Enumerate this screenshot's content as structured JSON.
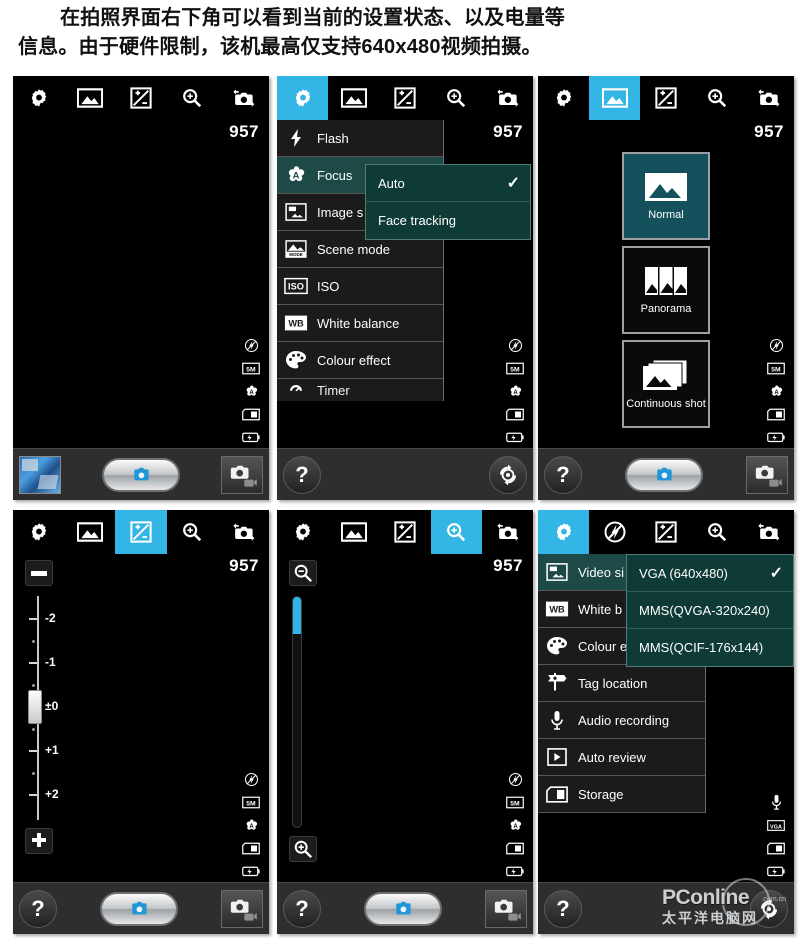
{
  "caption": {
    "line1": "在拍照界面右下角可以看到当前的设置状态、以及电量等",
    "line2": "信息。由于硬件限制，该机最高仅支持640x480视频拍摄。"
  },
  "toolbar": {
    "settings_label": "settings",
    "shot_mode_label": "shot-mode",
    "exposure_label": "exposure",
    "zoom_label": "zoom",
    "switch_camera_label": "switch-camera",
    "flash_label": "flash"
  },
  "common": {
    "counter": "957",
    "help_label": "?",
    "accent_color": "#33b5e5",
    "menu_selected_color": "#1d4a46",
    "submenu_color": "#0e3b36"
  },
  "panels": [
    {
      "id": "panel-camera-idle",
      "active_tool": "shot-mode-none",
      "counter": "957",
      "status_icons": [
        "flash-off-icon",
        "5m-size-icon",
        "auto-focus-icon",
        "sdcard-icon",
        "battery-icon"
      ],
      "bottom": {
        "thumbnail": "last-photo-thumbnail",
        "shutter": "shutter-button",
        "switch": "camera-video-switch"
      }
    },
    {
      "id": "panel-settings-menu",
      "active_tool": "settings",
      "counter": "957",
      "menu": [
        {
          "label": "Flash",
          "icon": "flash-icon",
          "selected": false
        },
        {
          "label": "Focus",
          "icon": "focus-flower-icon",
          "selected": true
        },
        {
          "label": "Image s",
          "icon": "image-size-icon",
          "selected": false
        },
        {
          "label": "Scene mode",
          "icon": "scene-mode-icon",
          "selected": false
        },
        {
          "label": "ISO",
          "icon": "iso-icon",
          "selected": false
        },
        {
          "label": "White balance",
          "icon": "wb-icon",
          "selected": false
        },
        {
          "label": "Colour effect",
          "icon": "palette-icon",
          "selected": false
        },
        {
          "label": "Timer",
          "icon": "timer-icon",
          "selected": false
        }
      ],
      "submenu": {
        "title": "Focus",
        "options": [
          {
            "label": "Auto",
            "checked": true
          },
          {
            "label": "Face tracking",
            "checked": false
          }
        ]
      },
      "status_icons": [
        "flash-off-icon",
        "5m-size-icon",
        "auto-focus-icon",
        "sdcard-icon",
        "battery-icon"
      ],
      "bottom": {
        "help": "?",
        "rotate": "switch-camera-round"
      }
    },
    {
      "id": "panel-shot-mode",
      "active_tool": "shot-mode",
      "counter": "957",
      "modes": [
        {
          "label": "Normal",
          "icon": "photo-icon",
          "selected": true
        },
        {
          "label": "Panorama",
          "icon": "panorama-icon",
          "selected": false
        },
        {
          "label": "Continuous shot",
          "icon": "burst-icon",
          "selected": false
        }
      ],
      "status_icons": [
        "flash-off-icon",
        "5m-size-icon",
        "auto-focus-icon",
        "sdcard-icon",
        "battery-icon"
      ],
      "bottom": {
        "help": "?",
        "shutter": "shutter-button",
        "switch": "camera-video-switch"
      }
    },
    {
      "id": "panel-exposure",
      "active_tool": "exposure",
      "counter": "957",
      "slider": {
        "decrease_label": "exposure-decrease",
        "increase_label": "exposure-increase",
        "ticks": [
          "-2",
          "-1",
          "±0",
          "+1",
          "+2"
        ],
        "value": "±0"
      },
      "status_icons": [
        "flash-off-icon",
        "5m-size-icon",
        "auto-focus-icon",
        "sdcard-icon",
        "battery-icon"
      ],
      "bottom": {
        "help": "?",
        "shutter": "shutter-button",
        "switch": "camera-video-switch"
      }
    },
    {
      "id": "panel-zoom",
      "active_tool": "zoom",
      "counter": "957",
      "slider": {
        "zoom_out_label": "zoom-out",
        "zoom_in_label": "zoom-in",
        "fill_percent": 16
      },
      "status_icons": [
        "flash-off-icon",
        "5m-size-icon",
        "auto-focus-icon",
        "sdcard-icon",
        "battery-icon"
      ],
      "bottom": {
        "help": "?",
        "shutter": "shutter-button",
        "switch": "camera-video-switch"
      }
    },
    {
      "id": "panel-video-settings",
      "active_tool": "settings",
      "menu": [
        {
          "label": "Video si",
          "icon": "image-size-icon",
          "selected": true
        },
        {
          "label": "White b",
          "icon": "wb-icon",
          "selected": false
        },
        {
          "label": "Colour e",
          "icon": "palette-icon",
          "selected": false
        },
        {
          "label": "Tag location",
          "icon": "location-icon",
          "selected": false
        },
        {
          "label": "Audio recording",
          "icon": "microphone-icon",
          "selected": false
        },
        {
          "label": "Auto review",
          "icon": "play-icon",
          "selected": false
        },
        {
          "label": "Storage",
          "icon": "sdcard-icon",
          "selected": false
        }
      ],
      "submenu": {
        "title": "Video size",
        "options": [
          {
            "label": "VGA (640x480)",
            "checked": true
          },
          {
            "label": "MMS(QVGA-320x240)",
            "checked": false
          },
          {
            "label": "MMS(QCIF-176x144)",
            "checked": false
          }
        ]
      },
      "status_icons": [
        "microphone-icon",
        "vga-icon",
        "sdcard-icon",
        "battery-icon"
      ],
      "bottom": {
        "help": "?",
        "rotate": "switch-camera-round"
      }
    }
  ],
  "watermark": {
    "brand": "PConline",
    "domain": ".com.cn",
    "chinese": "太平洋电脑网"
  }
}
